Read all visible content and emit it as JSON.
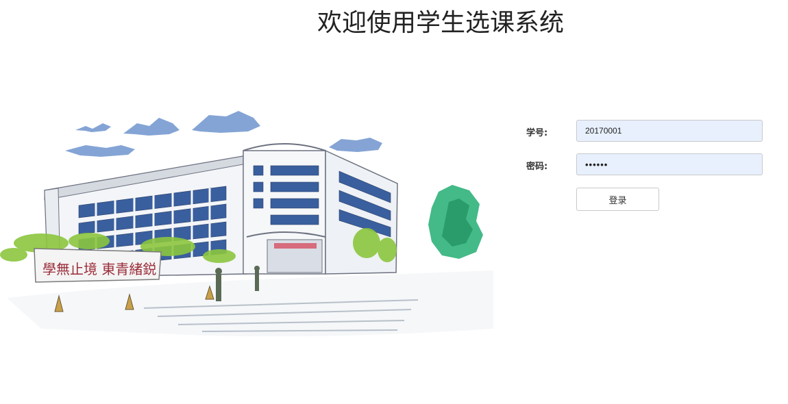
{
  "header": {
    "title": "欢迎使用学生选课系统"
  },
  "illustration": {
    "description_icon": "campus-building-sketch",
    "sign_text": "學無止境 東青緒鋭"
  },
  "login_form": {
    "student_id_label": "学号:",
    "student_id_value": "20170001",
    "password_label": "密码:",
    "password_value": "123456",
    "login_button_label": "登录"
  },
  "colors": {
    "input_autofill_bg": "#e8f0fe",
    "title_text": "#222222",
    "sign_text": "#9b2d3a",
    "tree_green": "#2fb37a",
    "sky_blue": "#5c86c7"
  }
}
